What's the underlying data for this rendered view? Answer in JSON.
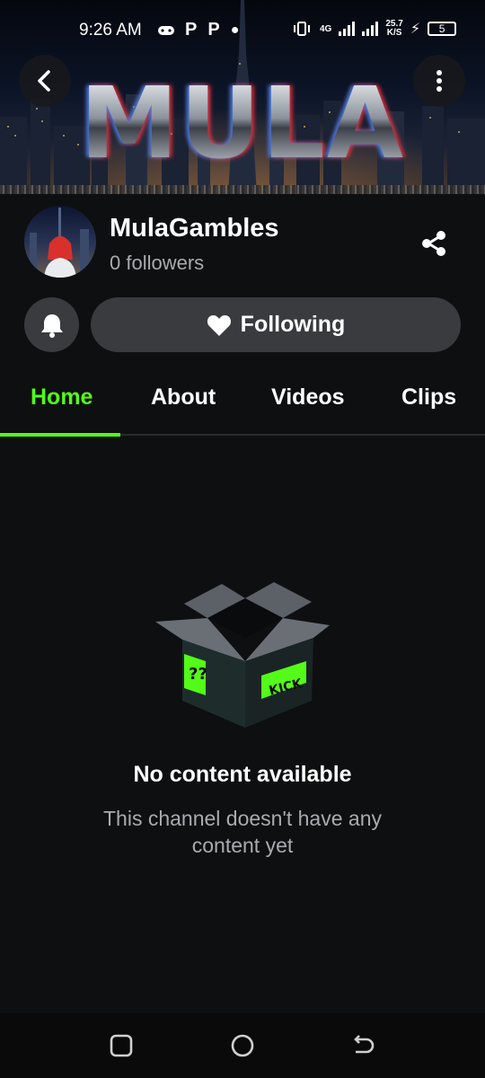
{
  "status_bar": {
    "time": "9:26 AM",
    "left_icons": [
      "gamepad-icon",
      "P",
      "P",
      "•"
    ],
    "network": "4G",
    "speed_value": "25.7",
    "speed_unit": "K/S",
    "battery": "5"
  },
  "banner": {
    "title": "MULA",
    "back_icon": "chevron-left-icon",
    "menu_icon": "more-vertical-icon"
  },
  "channel": {
    "name": "MulaGambles",
    "followers": "0 followers"
  },
  "actions": {
    "following_label": "Following",
    "bell_icon": "bell-icon",
    "share_icon": "share-icon"
  },
  "tabs": [
    {
      "label": "Home",
      "active": true
    },
    {
      "label": "About",
      "active": false
    },
    {
      "label": "Videos",
      "active": false
    },
    {
      "label": "Clips",
      "active": false
    }
  ],
  "empty_state": {
    "title": "No content available",
    "description": "This channel doesn't have any content yet",
    "box_sticker_text": "KICK"
  },
  "colors": {
    "accent": "#53fc18",
    "background": "#0e0f11",
    "button": "#3a3b3f",
    "muted_text": "#a9abb0"
  }
}
